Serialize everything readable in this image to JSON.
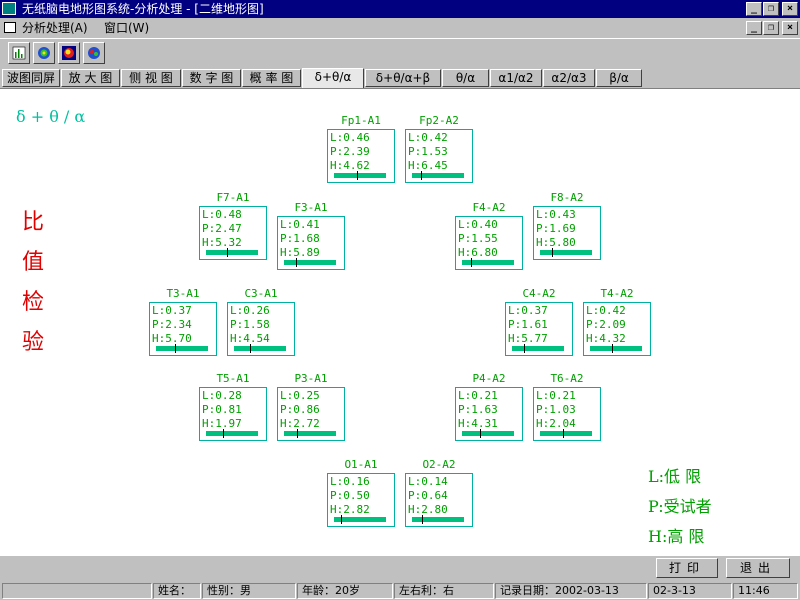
{
  "window": {
    "title": "无纸脑电地形图系统-分析处理 - [二维地形图]",
    "controls": [
      "_",
      "❐",
      "×"
    ]
  },
  "menu": {
    "items": [
      "分析处理(A)",
      "窗口(W)"
    ],
    "mdi_controls": [
      "_",
      "❐",
      "×"
    ]
  },
  "toolbar": {
    "icons": [
      "bar-chart-icon",
      "topo-map-icon",
      "brain-color-icon",
      "brain-grid-icon"
    ]
  },
  "tabs": [
    {
      "label": "波图同屏"
    },
    {
      "label": "放 大 图"
    },
    {
      "label": "侧 视 图"
    },
    {
      "label": "数 字 图"
    },
    {
      "label": "概 率 图"
    },
    {
      "label": "δ+θ/α",
      "active": true
    },
    {
      "label": "δ+θ/α+β"
    },
    {
      "label": "θ/α"
    },
    {
      "label": "α1/α2"
    },
    {
      "label": "α2/α3"
    },
    {
      "label": "β/α"
    }
  ],
  "main": {
    "formula": "δ + θ / α",
    "vertical_text": [
      "比",
      "值",
      "检",
      "验"
    ],
    "legend": [
      "L:低  限",
      "P:受试者",
      "H:高  限"
    ]
  },
  "channels": [
    {
      "name": "Fp1-A1",
      "L": "L:0.46",
      "P": "P:2.39",
      "H": "H:4.62",
      "pos": 0.45
    },
    {
      "name": "Fp2-A2",
      "L": "L:0.42",
      "P": "P:1.53",
      "H": "H:6.45",
      "pos": 0.18
    },
    {
      "name": "F7-A1",
      "L": "L:0.48",
      "P": "P:2.47",
      "H": "H:5.32",
      "pos": 0.4
    },
    {
      "name": "F3-A1",
      "L": "L:0.41",
      "P": "P:1.68",
      "H": "H:5.89",
      "pos": 0.23
    },
    {
      "name": "F4-A2",
      "L": "L:0.40",
      "P": "P:1.55",
      "H": "H:6.80",
      "pos": 0.18
    },
    {
      "name": "F8-A2",
      "L": "L:0.43",
      "P": "P:1.69",
      "H": "H:5.80",
      "pos": 0.23
    },
    {
      "name": "T3-A1",
      "L": "L:0.37",
      "P": "P:2.34",
      "H": "H:5.70",
      "pos": 0.37
    },
    {
      "name": "C3-A1",
      "L": "L:0.26",
      "P": "P:1.58",
      "H": "H:4.54",
      "pos": 0.31
    },
    {
      "name": "C4-A2",
      "L": "L:0.37",
      "P": "P:1.61",
      "H": "H:5.77",
      "pos": 0.23
    },
    {
      "name": "T4-A2",
      "L": "L:0.42",
      "P": "P:2.09",
      "H": "H:4.32",
      "pos": 0.43
    },
    {
      "name": "T5-A1",
      "L": "L:0.28",
      "P": "P:0.81",
      "H": "H:1.97",
      "pos": 0.32
    },
    {
      "name": "P3-A1",
      "L": "L:0.25",
      "P": "P:0.86",
      "H": "H:2.72",
      "pos": 0.25
    },
    {
      "name": "P4-A2",
      "L": "L:0.21",
      "P": "P:1.63",
      "H": "H:4.31",
      "pos": 0.35
    },
    {
      "name": "T6-A2",
      "L": "L:0.21",
      "P": "P:1.03",
      "H": "H:2.04",
      "pos": 0.45
    },
    {
      "name": "O1-A1",
      "L": "L:0.16",
      "P": "P:0.50",
      "H": "H:2.82",
      "pos": 0.13
    },
    {
      "name": "O2-A2",
      "L": "L:0.14",
      "P": "P:0.64",
      "H": "H:2.80",
      "pos": 0.19
    }
  ],
  "buttons": {
    "print": "打印",
    "exit": "退出"
  },
  "status": {
    "name": "姓名：",
    "sex": "性别：男",
    "age": "年龄：20岁",
    "hand": "左右利：右",
    "record_date": "记录日期：2002-03-13",
    "date": "02-3-13",
    "time": "11:46"
  },
  "colors": {
    "title_bg": "#000080",
    "node_text": "#00a000",
    "node_border": "#00b0a0",
    "bar": "#00c080",
    "vertical_text": "#e00000",
    "formula": "#00c0a0"
  }
}
